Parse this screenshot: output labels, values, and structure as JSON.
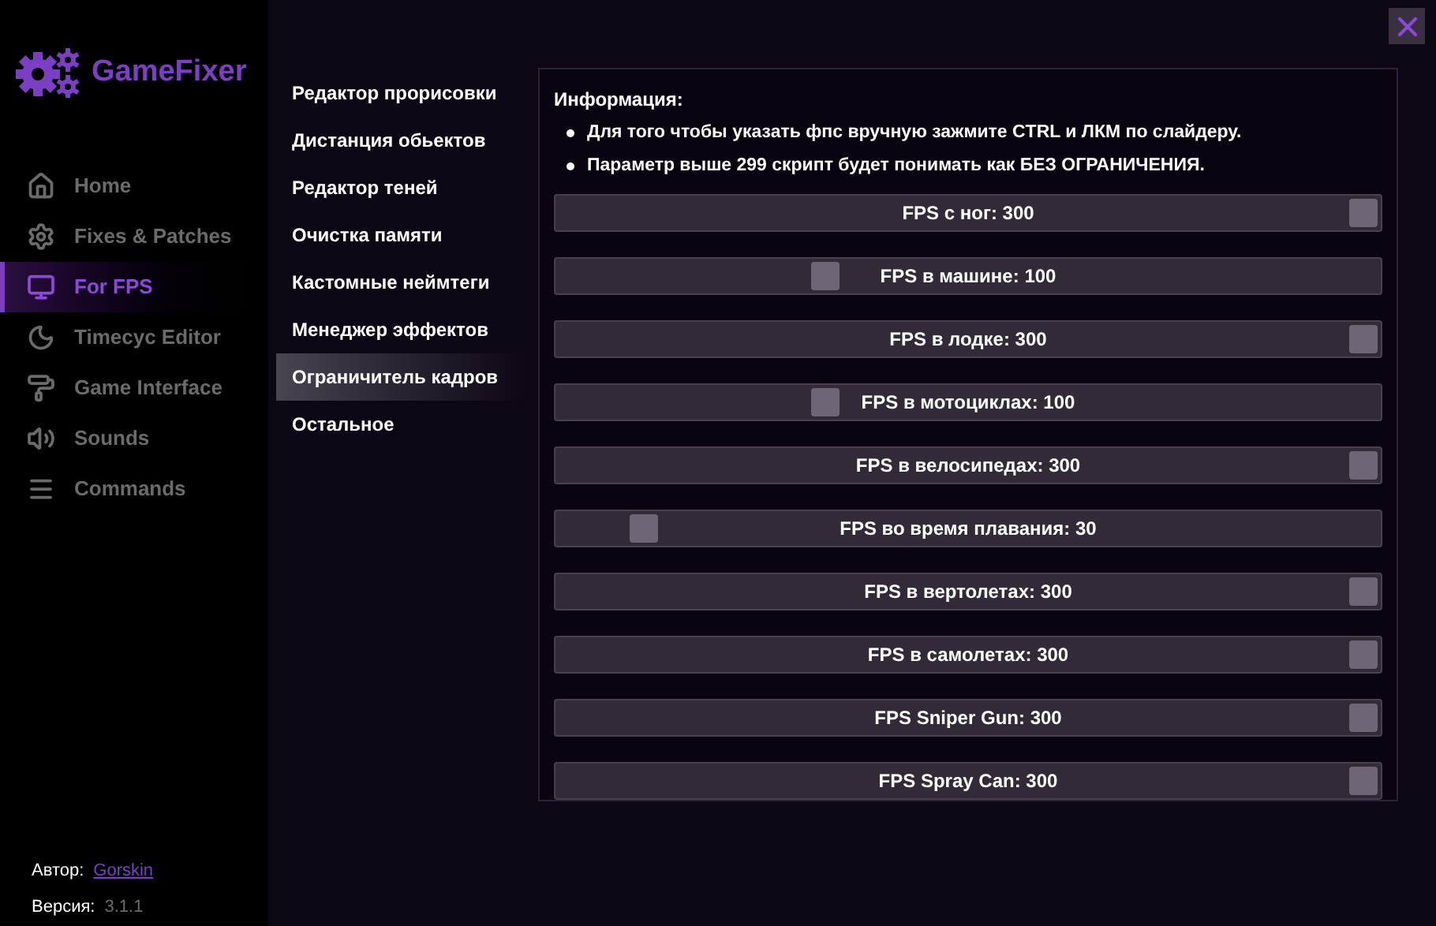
{
  "app": {
    "name": "GameFixer"
  },
  "nav": [
    {
      "label": "Home",
      "selected": false
    },
    {
      "label": "Fixes & Patches",
      "selected": false
    },
    {
      "label": "For FPS",
      "selected": true
    },
    {
      "label": "Timecyc Editor",
      "selected": false
    },
    {
      "label": "Game Interface",
      "selected": false
    },
    {
      "label": "Sounds",
      "selected": false
    },
    {
      "label": "Commands",
      "selected": false
    }
  ],
  "footer": {
    "author_label": "Автор:",
    "author": "Gorskin",
    "version_label": "Версия:",
    "version": "3.1.1"
  },
  "submenu": [
    {
      "label": "Редактор прорисовки",
      "selected": false
    },
    {
      "label": "Дистанция обьектов",
      "selected": false
    },
    {
      "label": "Редактор теней",
      "selected": false
    },
    {
      "label": "Очистка памяти",
      "selected": false
    },
    {
      "label": "Кастомные неймтеги",
      "selected": false
    },
    {
      "label": "Менеджер эффектов",
      "selected": false
    },
    {
      "label": "Ограничитель кадров",
      "selected": true
    },
    {
      "label": "Остальное",
      "selected": false
    }
  ],
  "info": {
    "title": "Информация:",
    "bullets": [
      "Для того чтобы указать фпс вручную зажмите CTRL и ЛКМ по слайдеру.",
      "Параметр выше 299 скрипт будет понимать как БЕЗ ОГРАНИЧЕНИЯ."
    ]
  },
  "sliders": [
    {
      "label": "FPS с ног: 300",
      "level": 1
    },
    {
      "label": "FPS в машине: 100",
      "level": 0.32
    },
    {
      "label": "FPS в лодке: 300",
      "level": 1
    },
    {
      "label": "FPS в мотоциклах: 100",
      "level": 0.32
    },
    {
      "label": "FPS в велосипедах: 300",
      "level": 1
    },
    {
      "label": "FPS во время плавания: 30",
      "level": 0.09
    },
    {
      "label": "FPS в вертолетах: 300",
      "level": 1
    },
    {
      "label": "FPS в самолетах: 300",
      "level": 1
    },
    {
      "label": "FPS Sniper Gun: 300",
      "level": 1
    },
    {
      "label": "FPS Spray Can: 300",
      "level": 1
    }
  ]
}
